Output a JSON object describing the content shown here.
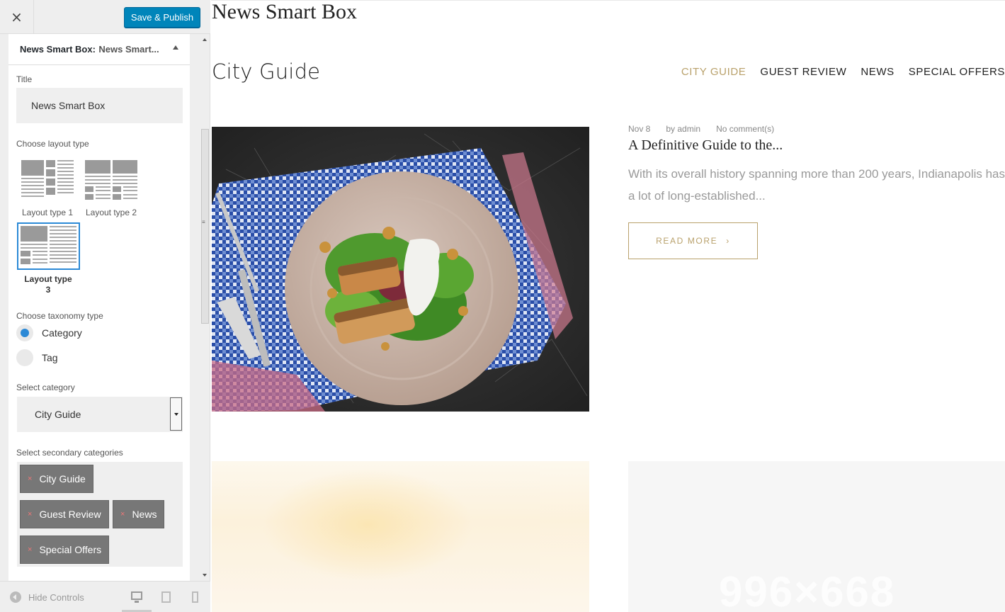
{
  "sidebar": {
    "close_label": "×",
    "save_label": "Save & Publish",
    "panel": {
      "title_prefix": "News Smart Box:",
      "title_suffix": "News Smart..."
    },
    "title_label": "Title",
    "title_value": "News Smart Box",
    "layout_label": "Choose layout type",
    "layouts": [
      {
        "label": "Layout type 1",
        "selected": false
      },
      {
        "label": "Layout type 2",
        "selected": false
      },
      {
        "label": "Layout type 3",
        "selected": true
      }
    ],
    "taxonomy_label": "Choose taxonomy type",
    "taxonomy_options": [
      {
        "label": "Category",
        "checked": true
      },
      {
        "label": "Tag",
        "checked": false
      }
    ],
    "category_label": "Select category",
    "category_value": "City Guide",
    "secondary_label": "Select secondary categories",
    "secondary_chips": [
      {
        "x": "×",
        "label": "City Guide"
      },
      {
        "x": "×",
        "label": "Guest Review"
      },
      {
        "x": "×",
        "label": "News"
      },
      {
        "x": "×",
        "label": "Special Offers"
      }
    ],
    "footer": {
      "hide_controls": "Hide Controls"
    }
  },
  "preview": {
    "widget_title": "News Smart Box",
    "box_title": "City Guide",
    "tabs": [
      {
        "label": "CITY GUIDE",
        "active": true
      },
      {
        "label": "GUEST REVIEW",
        "active": false
      },
      {
        "label": "NEWS",
        "active": false
      },
      {
        "label": "SPECIAL OFFERS",
        "active": false
      }
    ],
    "post": {
      "date": "Nov 8",
      "author": "by admin",
      "comments": "No comment(s)",
      "title": "A Definitive Guide to the...",
      "excerpt": "With its overall history spanning more than 200 years, Indianapolis has a lot of long-established...",
      "read_more": "READ MORE",
      "read_more_icon": "›"
    },
    "placeholder_text": "996×668"
  },
  "colors": {
    "accent": "#b9a16b",
    "primary_button": "#0085ba",
    "radio_selected": "#2b89d6"
  }
}
